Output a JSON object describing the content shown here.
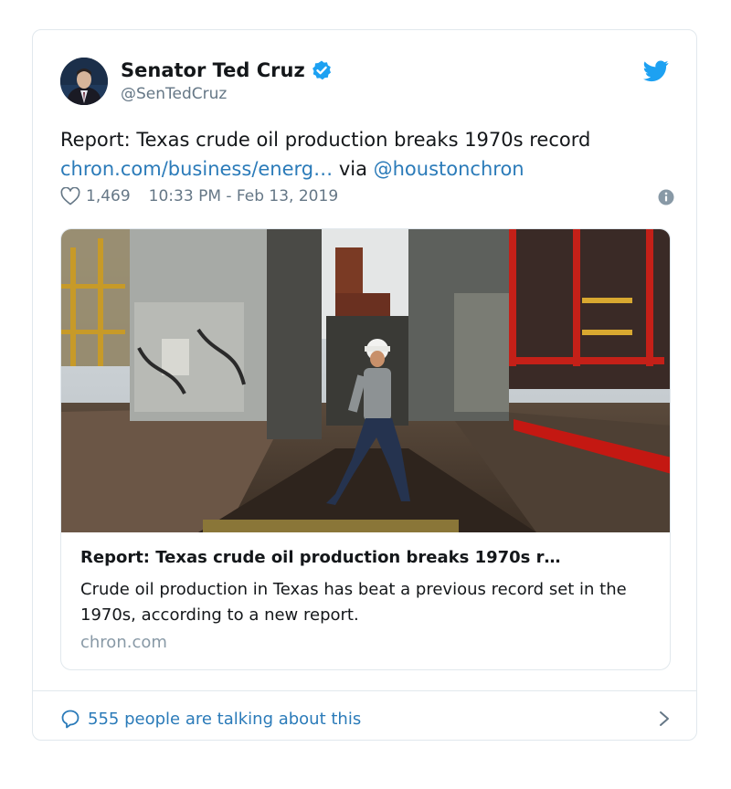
{
  "author": {
    "name": "Senator Ted Cruz",
    "handle": "@SenTedCruz"
  },
  "tweet": {
    "text": "Report: Texas crude oil production breaks 1970s record",
    "link_text": "chron.com/business/energ…",
    "via_text": " via ",
    "mention": "@houstonchron"
  },
  "meta": {
    "likes": "1,469",
    "timestamp": "10:33 PM - Feb 13, 2019"
  },
  "preview": {
    "title": "Report: Texas crude oil production breaks 1970s r…",
    "description": "Crude oil production in Texas has beat a previous record set in the 1970s, according to a new report.",
    "domain": "chron.com"
  },
  "footer": {
    "talking": "555 people are talking about this"
  },
  "colors": {
    "link": "#2b7bb9",
    "verified": "#1da1f2",
    "twitter_blue": "#1da1f2",
    "muted": "#657786"
  },
  "icons": [
    "verified-badge-icon",
    "twitter-bird-icon",
    "heart-icon",
    "info-icon",
    "speech-bubble-icon",
    "chevron-right-icon"
  ]
}
